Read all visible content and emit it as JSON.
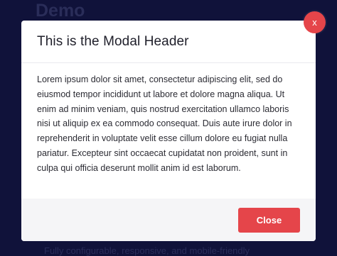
{
  "background": {
    "title": "Demo",
    "footer_text_fragment": "Fully configurable, responsive, and mobile-friendly"
  },
  "modal": {
    "header_title": "This is the Modal Header",
    "body_text": "Lorem ipsum dolor sit amet, consectetur adipiscing elit, sed do eiusmod tempor incididunt ut labore et dolore magna aliqua. Ut enim ad minim veniam, quis nostrud exercitation ullamco laboris nisi ut aliquip ex ea commodo consequat. Duis aute irure dolor in reprehenderit in voluptate velit esse cillum dolore eu fugiat nulla pariatur. Excepteur sint occaecat cupidatat non proident, sunt in culpa qui officia deserunt mollit anim id est laborum.",
    "close_button_label": "Close",
    "close_x_label": "x"
  },
  "colors": {
    "page_background": "#10123a",
    "accent": "#e5454a"
  }
}
